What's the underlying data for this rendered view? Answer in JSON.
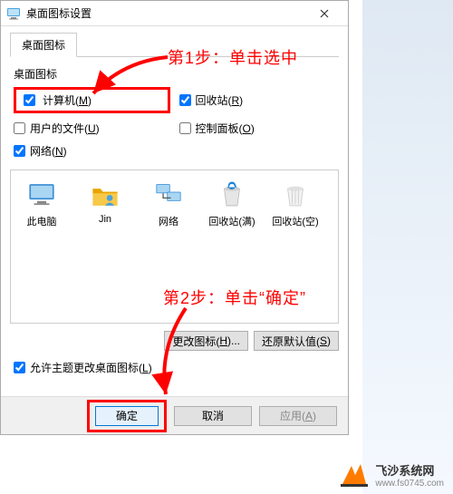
{
  "window": {
    "title": "桌面图标设置"
  },
  "tab": {
    "label": "桌面图标"
  },
  "group": {
    "title": "桌面图标"
  },
  "checkboxes": {
    "computer": {
      "label_pre": "计算机(",
      "hotkey": "M",
      "label_post": ")",
      "checked": true
    },
    "recycle": {
      "label_pre": "回收站(",
      "hotkey": "R",
      "label_post": ")",
      "checked": true
    },
    "userfiles": {
      "label_pre": "用户的文件(",
      "hotkey": "U",
      "label_post": ")",
      "checked": false
    },
    "controlpanel": {
      "label_pre": "控制面板(",
      "hotkey": "O",
      "label_post": ")",
      "checked": false
    },
    "network": {
      "label_pre": "网络(",
      "hotkey": "N",
      "label_post": ")",
      "checked": true
    }
  },
  "preview_icons": [
    {
      "id": "pc",
      "label": "此电脑"
    },
    {
      "id": "user",
      "label": "Jin"
    },
    {
      "id": "net",
      "label": "网络"
    },
    {
      "id": "bin_full",
      "label": "回收站(满)"
    },
    {
      "id": "bin_empty",
      "label": "回收站(空)"
    }
  ],
  "change_buttons": {
    "change": {
      "pre": "更改图标(",
      "hotkey": "H",
      "post": ")..."
    },
    "restore": {
      "pre": "还原默认值(",
      "hotkey": "S",
      "post": ")"
    }
  },
  "allow_themes": {
    "pre": "允许主题更改桌面图标(",
    "hotkey": "L",
    "post": ")",
    "checked": true
  },
  "bottom": {
    "ok": "确定",
    "cancel": "取消",
    "apply_pre": "应用(",
    "apply_hotkey": "A",
    "apply_post": ")"
  },
  "annotations": {
    "step1": "第1步：单击选中",
    "step2": "第2步：单击“确定”"
  },
  "watermark": {
    "name": "飞沙系统网",
    "url": "www.fs0745.com"
  }
}
